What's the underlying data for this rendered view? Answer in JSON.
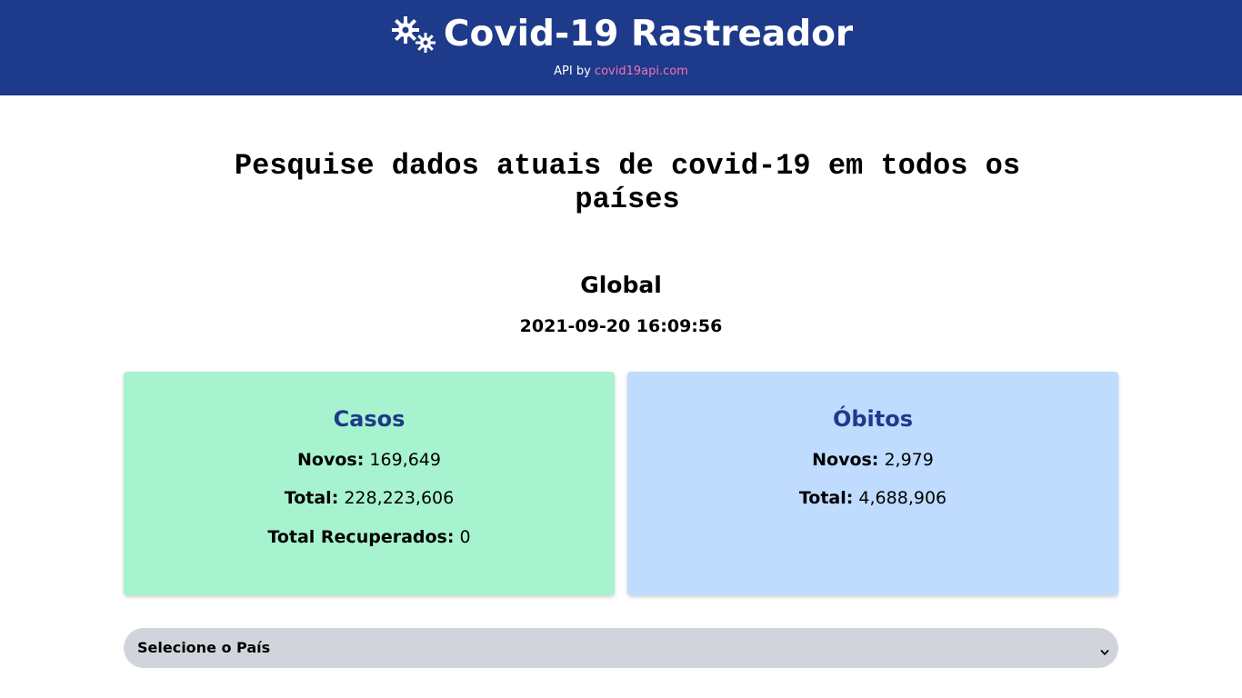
{
  "header": {
    "title": "Covid-19 Rastreador",
    "logo_icon": "virus-gears-icon",
    "api_prefix": "API by ",
    "api_link": "covid19api.com",
    "background": "#1e3a8a",
    "link_color": "#f472b6"
  },
  "main": {
    "headline": "Pesquise dados atuais de covid-19 em todos os países",
    "region": "Global",
    "date": "2021-09-20 16:09:56"
  },
  "cases": {
    "title": "Casos",
    "new_label": "Novos:",
    "new_value": "169,649",
    "total_label": "Total:",
    "total_value": "228,223,606",
    "recovered_label": "Total Recuperados:",
    "recovered_value": "0",
    "background": "#a7f3d0"
  },
  "deaths": {
    "title": "Óbitos",
    "new_label": "Novos:",
    "new_value": "2,979",
    "total_label": "Total:",
    "total_value": "4,688,906",
    "background": "#bfdbfe"
  },
  "country_select": {
    "selected": "Selecione o País",
    "icon": "chevron-down-icon"
  }
}
